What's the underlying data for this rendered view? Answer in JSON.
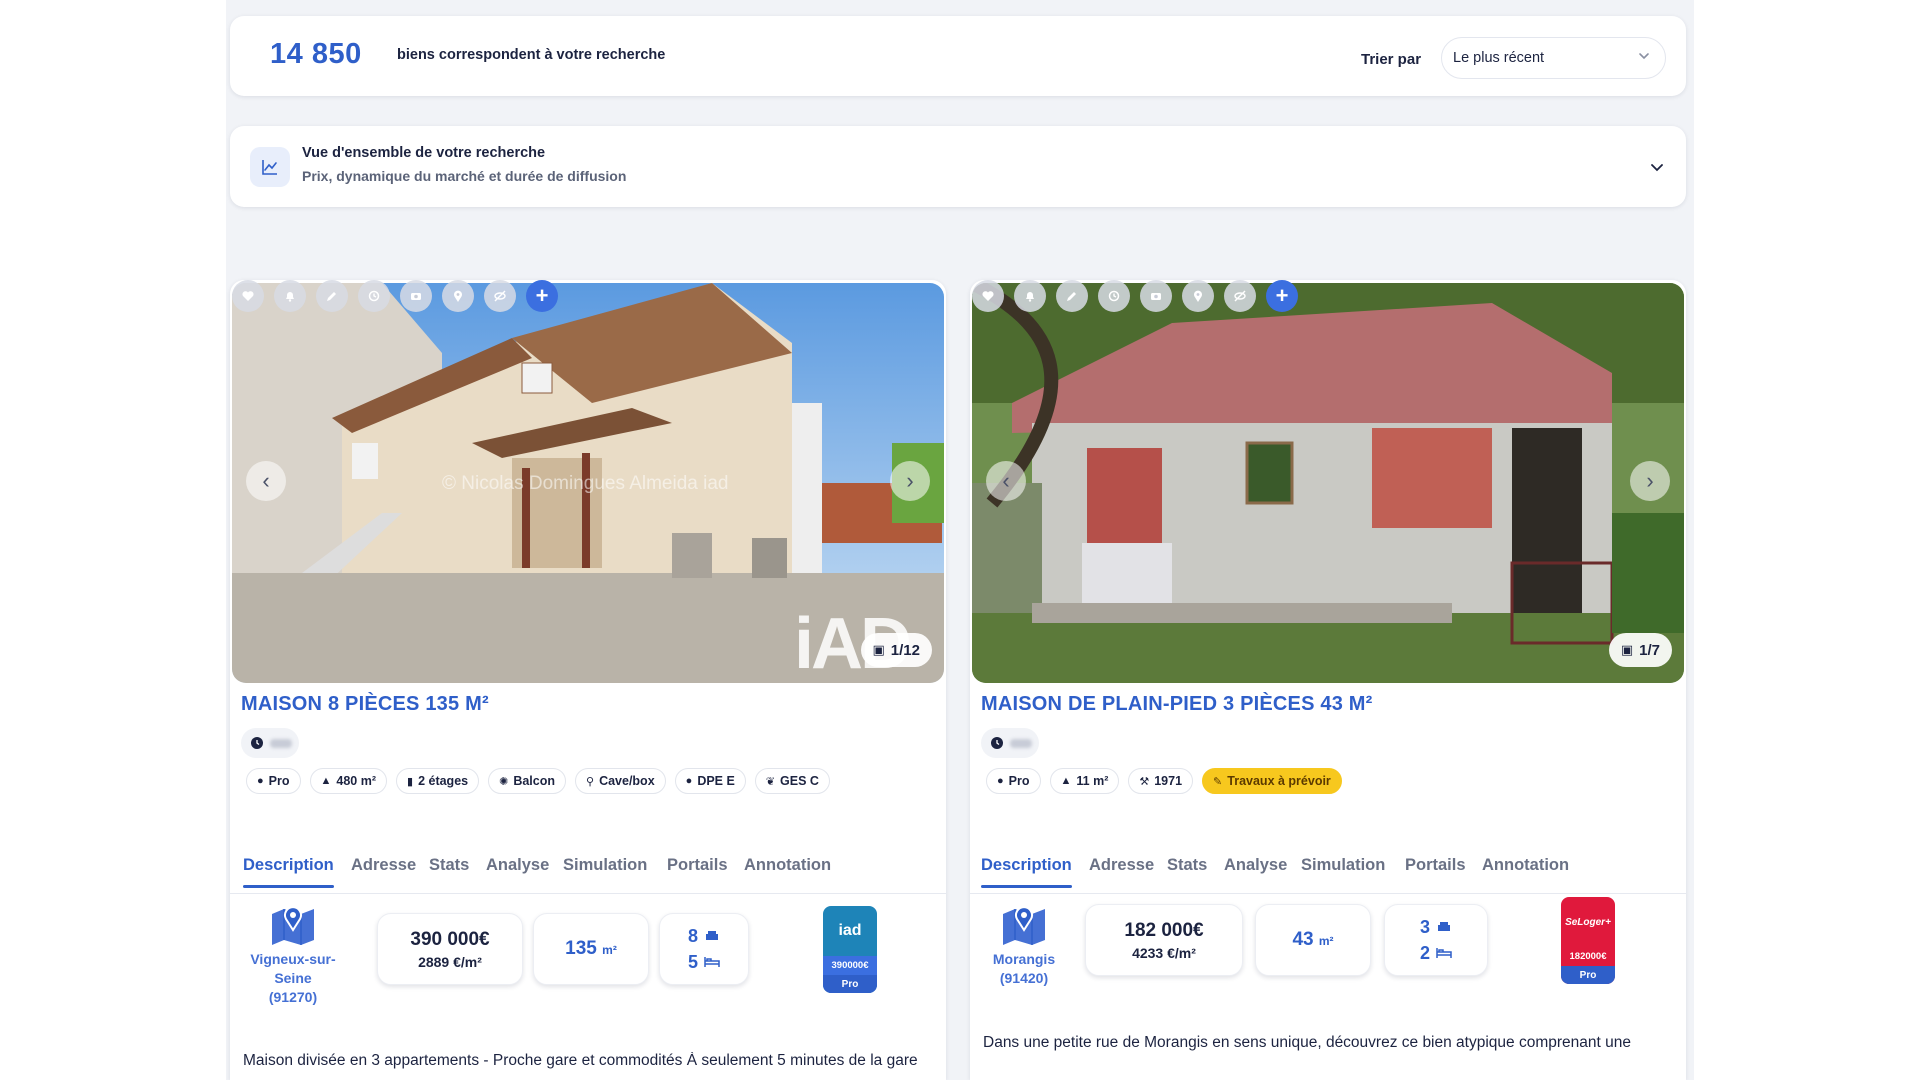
{
  "results": {
    "count": "14 850",
    "count_text": "biens correspondent à votre recherche",
    "sort_label": "Trier par",
    "sort_value": "Le plus récent"
  },
  "overview": {
    "title": "Vue d'ensemble de votre recherche",
    "subtitle": "Prix, dynamique du marché et durée de diffusion"
  },
  "tabs": [
    "Description",
    "Adresse",
    "Stats",
    "Analyse",
    "Simulation",
    "Portails",
    "Annotation"
  ],
  "action_icons": [
    "heart-icon",
    "bell-icon",
    "pencil-icon",
    "history-icon",
    "camera-icon",
    "pin-icon",
    "eye-off-icon",
    "plus-icon"
  ],
  "listings": [
    {
      "title": "MAISON 8 PIÈCES 135 M²",
      "photo_counter": "1/12",
      "watermark": "© Nicolas Domingues Almeida iad",
      "photo_brand": "iAD",
      "chips": [
        {
          "icon": "user-icon",
          "label": "Pro"
        },
        {
          "icon": "tree-icon",
          "label": "480 m²"
        },
        {
          "icon": "building-icon",
          "label": "2 étages"
        },
        {
          "icon": "balcony-icon",
          "label": "Balcon"
        },
        {
          "icon": "key-icon",
          "label": "Cave/box"
        },
        {
          "icon": "bulb-icon",
          "label": "DPE E"
        },
        {
          "icon": "leaf-icon",
          "label": "GES C"
        }
      ],
      "city": "Vigneux-sur-Seine",
      "postcode": "(91270)",
      "price": "390 000€",
      "price_per_m2": "2889 €/m²",
      "area_value": "135",
      "area_unit": "m²",
      "rooms": "8",
      "bedrooms": "5",
      "agency": {
        "name": "iad",
        "price": "390000€",
        "badge": "Pro"
      },
      "description": "Maison divisée en 3 appartements - Proche gare et commodités À seulement 5 minutes de la gare"
    },
    {
      "title": "MAISON DE PLAIN-PIED 3 PIÈCES 43 M²",
      "photo_counter": "1/7",
      "chips": [
        {
          "icon": "user-icon",
          "label": "Pro"
        },
        {
          "icon": "tree-icon",
          "label": "11 m²"
        },
        {
          "icon": "hammer-icon",
          "label": "1971"
        },
        {
          "icon": "brush-icon",
          "label": "Travaux à prévoir"
        }
      ],
      "city": "Morangis",
      "postcode": "(91420)",
      "price": "182 000€",
      "price_per_m2": "4233 €/m²",
      "area_value": "43",
      "area_unit": "m²",
      "rooms": "3",
      "bedrooms": "2",
      "agency": {
        "name": "SeLoger+",
        "price": "182000€",
        "badge": "Pro"
      },
      "description": "Dans une petite rue de Morangis en sens unique, découvrez ce bien atypique comprenant une"
    }
  ]
}
